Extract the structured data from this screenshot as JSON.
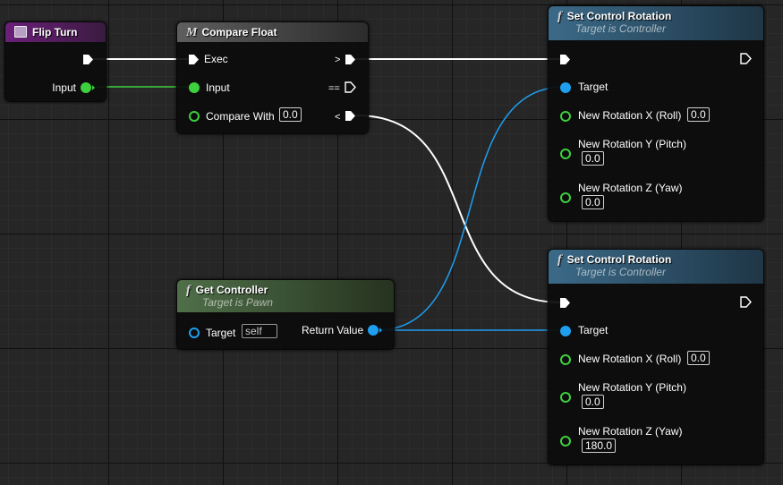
{
  "flip_turn": {
    "title": "Flip Turn",
    "input_label": "Input"
  },
  "compare_float": {
    "title": "Compare Float",
    "exec_label": "Exec",
    "input_label": "Input",
    "compare_with_label": "Compare With",
    "compare_with_value": "0.0",
    "gt_label": ">",
    "eq_label": "==",
    "lt_label": "<"
  },
  "get_controller": {
    "title": "Get Controller",
    "subtitle": "Target is Pawn",
    "target_label": "Target",
    "target_value": "self",
    "return_label": "Return Value"
  },
  "set_rotation_1": {
    "title": "Set Control Rotation",
    "subtitle": "Target is Controller",
    "target_label": "Target",
    "roll_label": "New Rotation X (Roll)",
    "roll_value": "0.0",
    "pitch_label": "New Rotation Y (Pitch)",
    "pitch_value": "0.0",
    "yaw_label": "New Rotation Z (Yaw)",
    "yaw_value": "0.0"
  },
  "set_rotation_2": {
    "title": "Set Control Rotation",
    "subtitle": "Target is Controller",
    "target_label": "Target",
    "roll_label": "New Rotation X (Roll)",
    "roll_value": "0.0",
    "pitch_label": "New Rotation Y (Pitch)",
    "pitch_value": "0.0",
    "yaw_label": "New Rotation Z (Yaw)",
    "yaw_value": "180.0"
  },
  "colors": {
    "exec_wire": "#ffffff",
    "float_wire": "#3ed13e",
    "object_wire": "#1e9ff0",
    "event_header": "#6b1f7a",
    "function_header": "#35607a",
    "pure_header": "#4c6a46",
    "macro_header": "#555555"
  },
  "icons": {
    "event": "event-icon",
    "function": "function-glyph-icon",
    "macro": "macro-glyph-icon",
    "exec_pin": "exec-pin-icon",
    "data_pin": "data-pin-icon"
  }
}
